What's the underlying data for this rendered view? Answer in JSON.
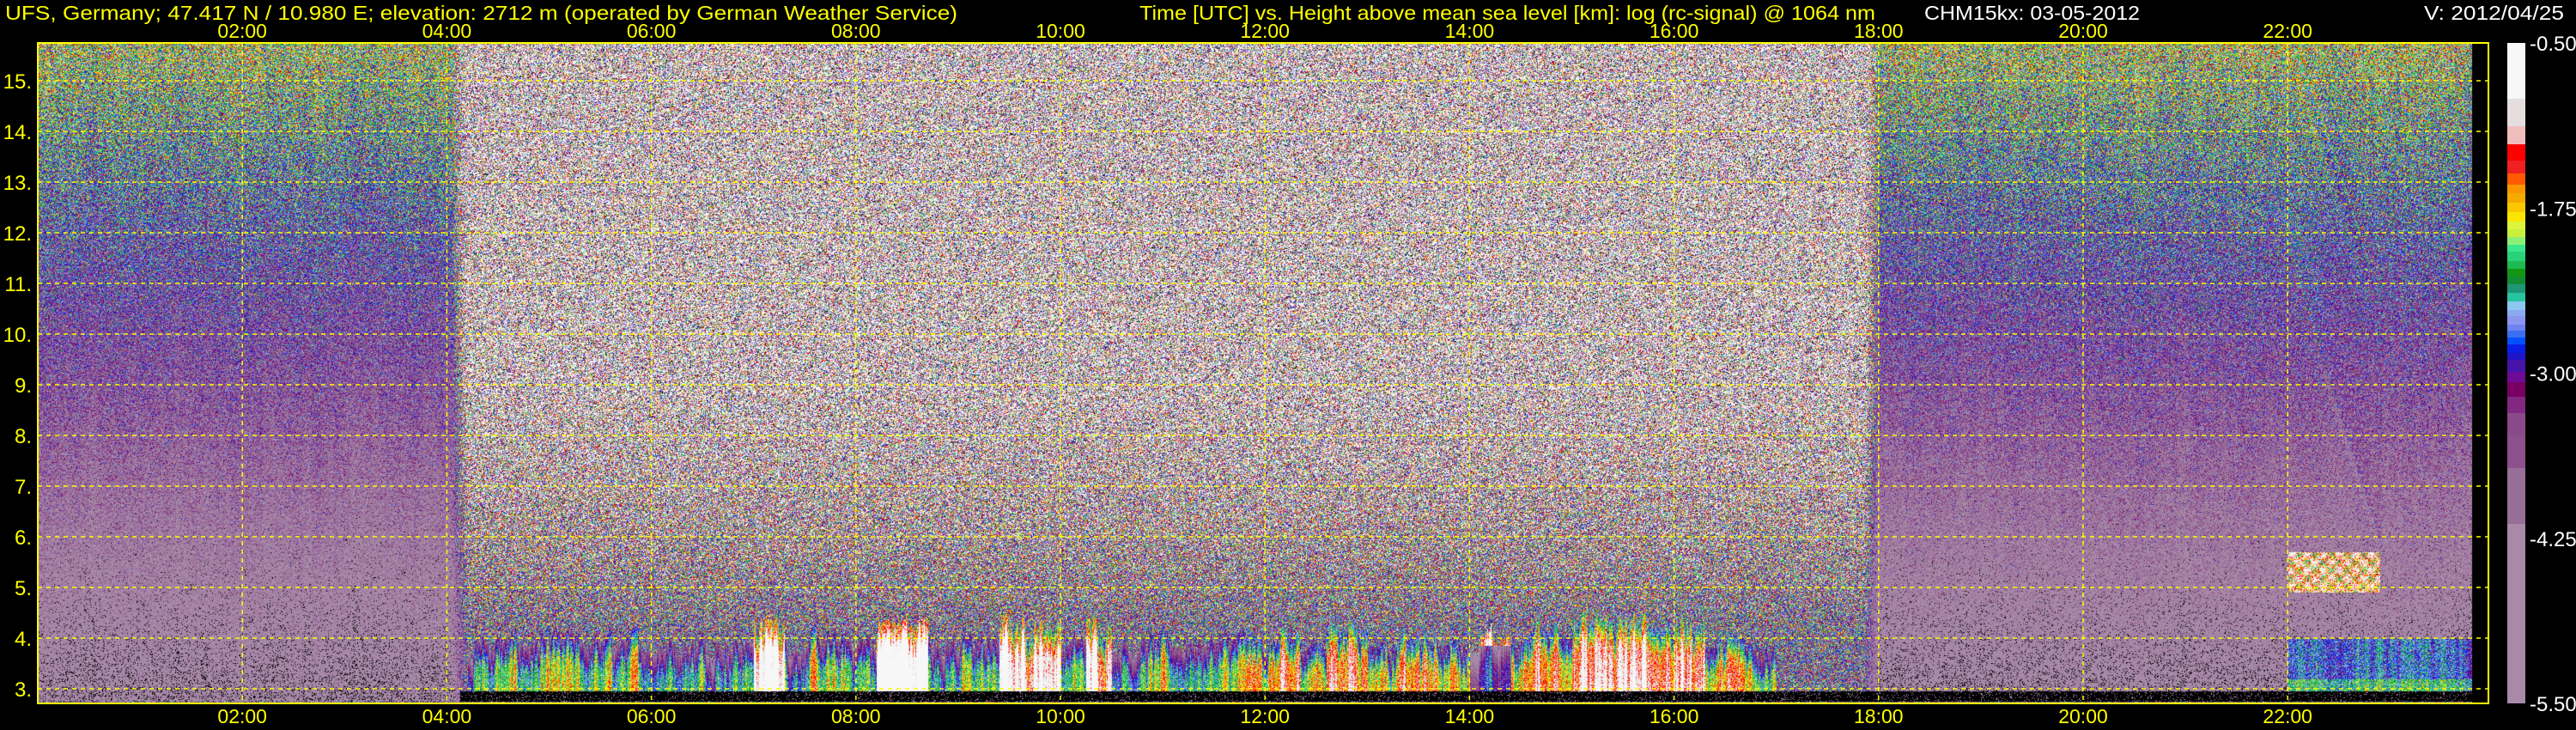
{
  "header": {
    "title_left": "UFS, Germany; 47.417 N / 10.980 E; elevation: 2712 m  (operated by German Weather Service)",
    "title_center": "Time [UTC] vs. Height above mean sea level [km]: log (rc-signal) @ 1064 nm",
    "instrument": "CHM15kx: 03-05-2012",
    "version": "V: 2012/04/25"
  },
  "colors": {
    "label_yellow": "#ffff00",
    "label_white": "#ffffff",
    "grid": "#ffff00",
    "background": "#000000",
    "below_range": "#000000"
  },
  "chart_data": {
    "type": "heatmap",
    "x_ticks": [
      "02:00",
      "04:00",
      "06:00",
      "08:00",
      "10:00",
      "12:00",
      "14:00",
      "16:00",
      "18:00",
      "20:00",
      "22:00"
    ],
    "x_tick_hours": [
      2,
      4,
      6,
      8,
      10,
      12,
      14,
      16,
      18,
      20,
      22
    ],
    "xlim_hours": [
      0,
      24
    ],
    "y_ticks": [
      "3.",
      "4.",
      "5.",
      "6.",
      "7.",
      "8.",
      "9.",
      "10.",
      "11.",
      "12.",
      "13.",
      "14.",
      "15."
    ],
    "y_tick_values": [
      3,
      4,
      5,
      6,
      7,
      8,
      9,
      10,
      11,
      12,
      13,
      14,
      15
    ],
    "ylim": [
      2.712,
      15.75
    ],
    "grid": true,
    "colorbar": {
      "ticks": [
        "-0.50",
        "-1.75",
        "-3.00",
        "-4.25",
        "-5.50"
      ],
      "tick_values": [
        -0.5,
        -1.75,
        -3.0,
        -4.25,
        -5.5
      ],
      "range": [
        -5.5,
        -0.5
      ],
      "levels": [
        -0.92,
        -1.13,
        -1.27,
        -1.39,
        -1.49,
        -1.57,
        -1.64,
        -1.71,
        -1.78,
        -1.85,
        -1.91,
        -1.97,
        -2.03,
        -2.08,
        -2.15,
        -2.21,
        -2.27,
        -2.33,
        -2.39,
        -2.46,
        -2.52,
        -2.57,
        -2.63,
        -2.68,
        -2.73,
        -2.78,
        -2.85,
        -2.9,
        -2.99,
        -3.07,
        -3.18,
        -3.3,
        -3.47,
        -3.72,
        -4.14
      ],
      "colors": [
        "#f7f7f7",
        "#e6dede",
        "#f0bcbc",
        "#ff0000",
        "#f02020",
        "#ff5a00",
        "#fa9600",
        "#f5aa00",
        "#fac800",
        "#fae600",
        "#dcf53c",
        "#c8f03c",
        "#8cf078",
        "#3ce68c",
        "#28d278",
        "#1eb950",
        "#149614",
        "#148c32",
        "#1e9678",
        "#28c3a0",
        "#8cc8f0",
        "#8caaf0",
        "#8c96f0",
        "#6e82f0",
        "#3c6ef0",
        "#0050ff",
        "#0a1ee6",
        "#1e14c8",
        "#4614aa",
        "#6e0a96",
        "#780064",
        "#822882",
        "#8a4a8a",
        "#8c508c",
        "#966e96",
        "#a88aa8"
      ]
    }
  }
}
